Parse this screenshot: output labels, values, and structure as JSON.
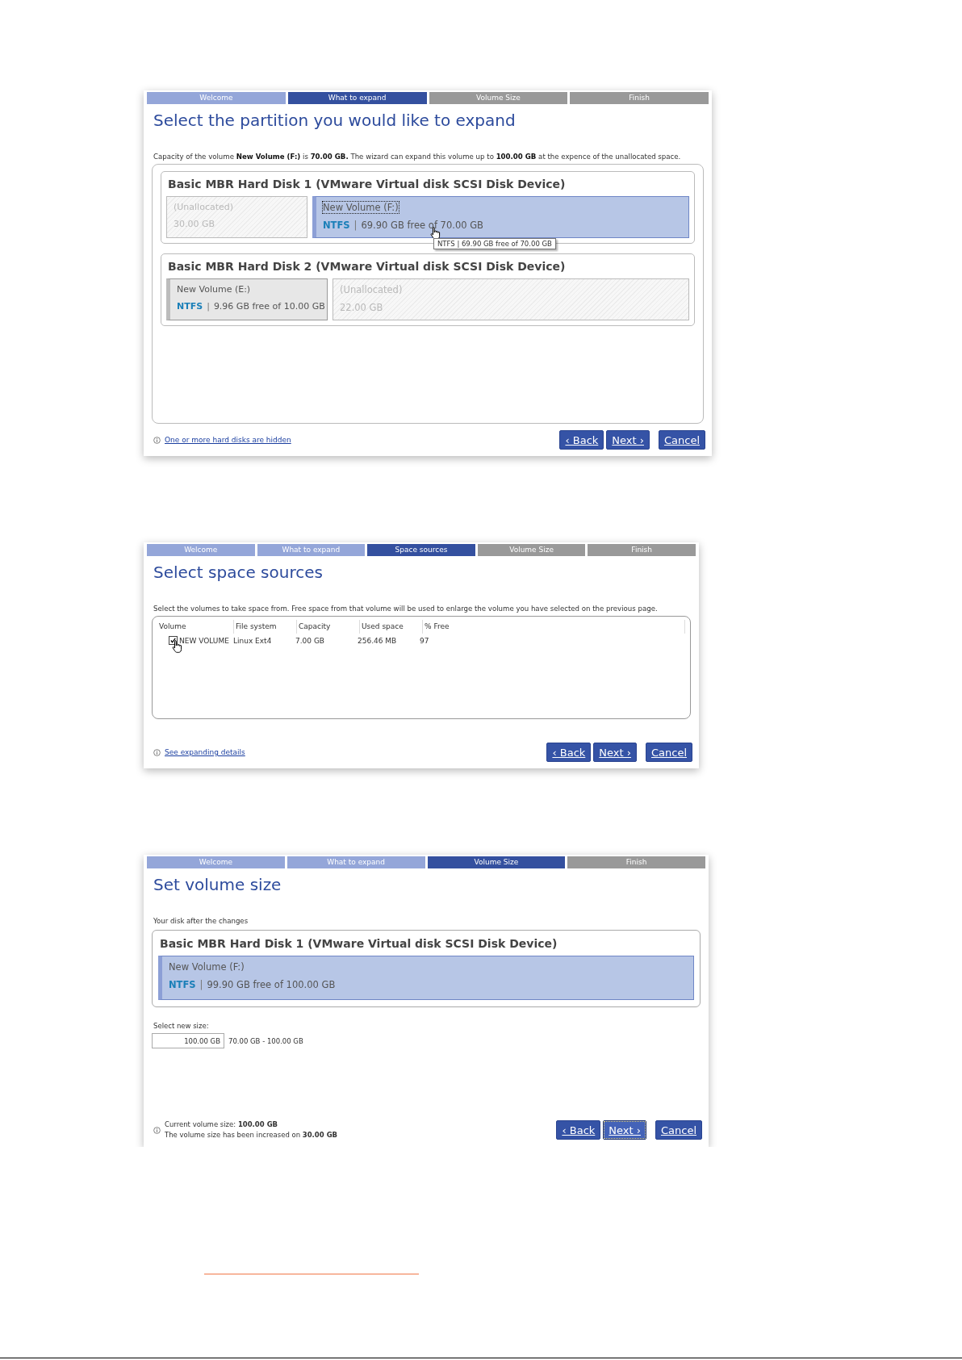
{
  "panels": [
    {
      "kind": "partitions",
      "steps": [
        {
          "label": "Welcome",
          "done": true,
          "selected": false
        },
        {
          "label": "What to expand",
          "selected": true
        },
        {
          "label": "Volume Size",
          "done": false,
          "selected": false
        },
        {
          "label": "Finish",
          "done": false,
          "selected": false
        }
      ],
      "title": "Select the partition you would like to expand",
      "description": "Capacity of the volume **New Volume (F:)** is **70.00 GB.** The wizard can expand this volume up to **100.00 GB** at the expence of the unallocated space.",
      "disks": [
        {
          "title": "Basic MBR Hard Disk 1 (VMware Virtual disk SCSI Disk Device)",
          "partitions": [
            {
              "kind": "unallocated",
              "name": "(Unallocated)",
              "size": "30.00 GB"
            },
            {
              "kind": "volume",
              "name": "New Volume (F:)",
              "fs": "NTFS",
              "sep": "|",
              "info": "69.90 GB free of 70.00 GB",
              "selected": true,
              "focused": true,
              "pointer": true,
              "tooltip": "NTFS | 69.90 GB free of 70.00 GB"
            }
          ]
        },
        {
          "title": "Basic MBR Hard Disk 2 (VMware Virtual disk SCSI Disk Device)",
          "partitions": [
            {
              "kind": "volume",
              "name": "New Volume (E:)",
              "fs": "NTFS",
              "sep": "|",
              "info": "9.96 GB free of 10.00 GB",
              "selected": false,
              "focused": false
            },
            {
              "kind": "unallocated",
              "name": "(Unallocated)",
              "size": "22.00 GB"
            }
          ]
        }
      ],
      "footer": {
        "link": "One or more hard disks are hidden"
      },
      "buttons": [
        {
          "label": "‹ Back",
          "focused": false
        },
        {
          "label": "Next ›",
          "focused": false
        },
        {
          "label": "Cancel",
          "focused": false
        }
      ]
    },
    {
      "kind": "table",
      "steps": [
        {
          "label": "Welcome",
          "done": true,
          "selected": false
        },
        {
          "label": "What to expand",
          "done": true,
          "selected": false
        },
        {
          "label": "Space sources",
          "selected": true
        },
        {
          "label": "Volume Size",
          "done": false,
          "selected": false
        },
        {
          "label": "Finish",
          "done": false,
          "selected": false
        }
      ],
      "title": "Select space sources",
      "description": "Select the volumes to take space from. Free space from that volume will be used to enlarge the volume you have selected on the previous page.",
      "table": {
        "columns": [
          "Volume",
          "File system",
          "Capacity",
          "Used space",
          "% Free"
        ],
        "rows": [
          {
            "checked": true,
            "pointer": true,
            "cells": [
              "NEW VOLUME",
              "Linux Ext4",
              "7.00 GB",
              "256.46 MB",
              "97"
            ]
          }
        ]
      },
      "footer": {
        "link": "See expanding details"
      },
      "buttons": [
        {
          "label": "‹ Back",
          "focused": false
        },
        {
          "label": "Next ›",
          "focused": false
        },
        {
          "label": "Cancel",
          "focused": false
        }
      ]
    },
    {
      "kind": "size",
      "steps": [
        {
          "label": "Welcome",
          "done": true,
          "selected": false
        },
        {
          "label": "What to expand",
          "done": true,
          "selected": false
        },
        {
          "label": "Volume Size",
          "selected": true
        },
        {
          "label": "Finish",
          "done": false,
          "selected": false
        }
      ],
      "title": "Set volume size",
      "description": "Your disk after the changes",
      "disks": [
        {
          "title": "Basic MBR Hard Disk 1 (VMware Virtual disk SCSI Disk Device)",
          "partitions": [
            {
              "kind": "volume",
              "name": "New Volume (F:)",
              "fs": "NTFS",
              "sep": "|",
              "info": "99.90 GB free of 100.00 GB",
              "selected": true,
              "focused": false
            }
          ]
        }
      ],
      "size_label": "Select new size:",
      "size_value": "100.00 GB",
      "size_range": "70.00 GB - 100.00 GB",
      "footer": {
        "notes": [
          "Current volume size: **100.00 GB**",
          "The volume size has been increased on **30.00 GB**"
        ]
      },
      "buttons": [
        {
          "label": "‹ Back",
          "focused": false
        },
        {
          "label": "Next ›",
          "focused": true
        },
        {
          "label": "Cancel",
          "focused": false
        }
      ]
    }
  ]
}
